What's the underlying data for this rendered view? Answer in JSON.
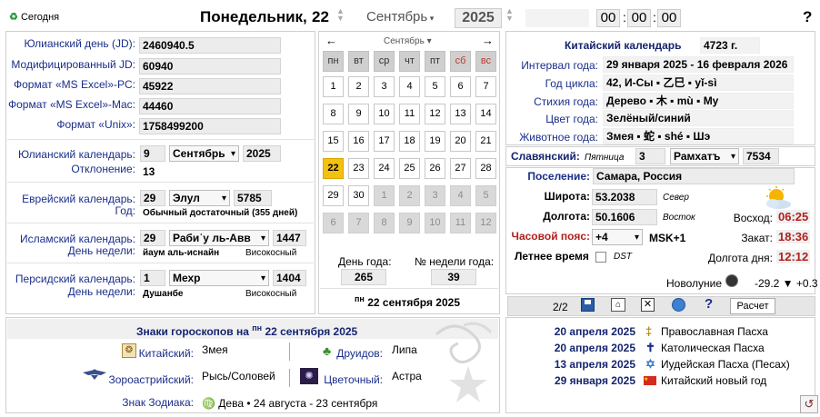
{
  "header": {
    "today_label": "Сегодня",
    "weekday": "Понедельник,",
    "day": "22",
    "month": "Сентябрь",
    "year": "2025",
    "hh": "00",
    "mm": "00",
    "ss": "00",
    "help": "?"
  },
  "dates": {
    "jd_label": "Юлианский день (JD):",
    "jd": "2460940.5",
    "mjd_label": "Модифицированный JD:",
    "mjd": "60940",
    "excel_pc_label": "Формат «MS Excel»-PC:",
    "excel_pc": "45922",
    "excel_mac_label": "Формат «MS Excel»-Mac:",
    "excel_mac": "44460",
    "unix_label": "Формат «Unix»:",
    "unix": "1758499200"
  },
  "julian": {
    "label": "Юлианский календарь:",
    "day": "9",
    "month": "Сентябрь",
    "year": "2025",
    "offset_label": "Отклонение:",
    "offset": "13"
  },
  "hebrew": {
    "label": "Еврейский календарь:",
    "day": "29",
    "month": "Элул",
    "year": "5785",
    "year_label": "Год:",
    "year_type": "Обычный достаточный (355 дней)"
  },
  "islamic": {
    "label": "Исламский календарь:",
    "day": "29",
    "month": "Рабиʿу ль-Авв",
    "year": "1447",
    "weekday_label": "День недели:",
    "weekday": "йаум аль-иснайн",
    "leap": "Високосный"
  },
  "persian": {
    "label": "Персидский календарь:",
    "day": "1",
    "month": "Мехр",
    "year": "1404",
    "weekday_label": "День недели:",
    "weekday": "Душанбе",
    "leap": "Високосный"
  },
  "calendar": {
    "prev": "←",
    "next": "→",
    "month": "Сентябрь",
    "weekdays": [
      "пн",
      "вт",
      "ср",
      "чт",
      "пт",
      "сб",
      "вс"
    ],
    "weeks": [
      [
        "1",
        "2",
        "3",
        "4",
        "5",
        "6",
        "7"
      ],
      [
        "8",
        "9",
        "10",
        "11",
        "12",
        "13",
        "14"
      ],
      [
        "15",
        "16",
        "17",
        "18",
        "19",
        "20",
        "21"
      ],
      [
        "22",
        "23",
        "24",
        "25",
        "26",
        "27",
        "28"
      ],
      [
        "29",
        "30",
        "1",
        "2",
        "3",
        "4",
        "5"
      ],
      [
        "6",
        "7",
        "8",
        "9",
        "10",
        "11",
        "12"
      ]
    ],
    "day_of_year_label": "День года:",
    "day_of_year": "265",
    "week_no_label": "№ недели года:",
    "week_no": "39",
    "footer_dow": "пн",
    "footer_date": "22 сентября 2025"
  },
  "chinese": {
    "title": "Китайский календарь",
    "year": "4723 г.",
    "interval_label": "Интервал года:",
    "interval": "29 января 2025  -  16 февраля 2026",
    "cycle_label": "Год цикла:",
    "cycle": "42,  И-Сы  ▪  乙巳  ▪  yǐ-sì",
    "element_label": "Стихия года:",
    "element": "Дерево  ▪ 木 ▪ mù ▪ Му",
    "color_label": "Цвет года:",
    "color": "Зелёный/синий",
    "animal_label": "Животное года:",
    "animal": "Змея  ▪ 蛇 ▪ shé  ▪ Шэ"
  },
  "slavic": {
    "label": "Славянский:",
    "weekday": "Пятница",
    "day": "3",
    "month": "Рамхатъ",
    "year": "7534"
  },
  "location": {
    "place_label": "Поселение:",
    "place": "Самара, Россия",
    "lat_label": "Широта:",
    "lat": "53.2038",
    "lat_dir": "Север",
    "lon_label": "Долгота:",
    "lon": "50.1606",
    "lon_dir": "Восток",
    "tz_label": "Часовой пояс:",
    "tz": "+4",
    "tz_name": "MSK+1",
    "dst_label": "Летнее время",
    "dst": "DST",
    "sunrise_label": "Восход:",
    "sunrise": "06:25",
    "sunset_label": "Закат:",
    "sunset": "18:36",
    "daylen_label": "Долгота дня:",
    "daylen": "12:12",
    "newmoon_label": "Новолуние",
    "moon_value": "-29.2 ▼ +0.3"
  },
  "toolbar": {
    "page": "2/2",
    "calc": "Расчет"
  },
  "horoscope": {
    "title": "Знаки гороскопов на",
    "dow": "пн",
    "date": "22 сентября 2025",
    "chinese_label": "Китайский:",
    "chinese": "Змея",
    "druid_label": "Друидов:",
    "druid": "Липа",
    "zoro_label": "Зороастрийский:",
    "zoro": "Рысь/Соловей",
    "flower_label": "Цветочный:",
    "flower": "Астра",
    "zodiac_label": "Знак Зодиака:",
    "zodiac": "♍ Дева • 24 августа - 23 сентября"
  },
  "holidays": [
    {
      "date": "20 апреля 2025",
      "icon": "‡",
      "name": "Православная Пасха"
    },
    {
      "date": "20 апреля 2025",
      "icon": "✝",
      "name": "Католическая Пасха"
    },
    {
      "date": "13 апреля 2025",
      "icon": "✡",
      "name": "Иудейская Пасха (Песах)"
    },
    {
      "date": "29 января 2025",
      "icon": "flag",
      "name": "Китайский новый год"
    }
  ]
}
